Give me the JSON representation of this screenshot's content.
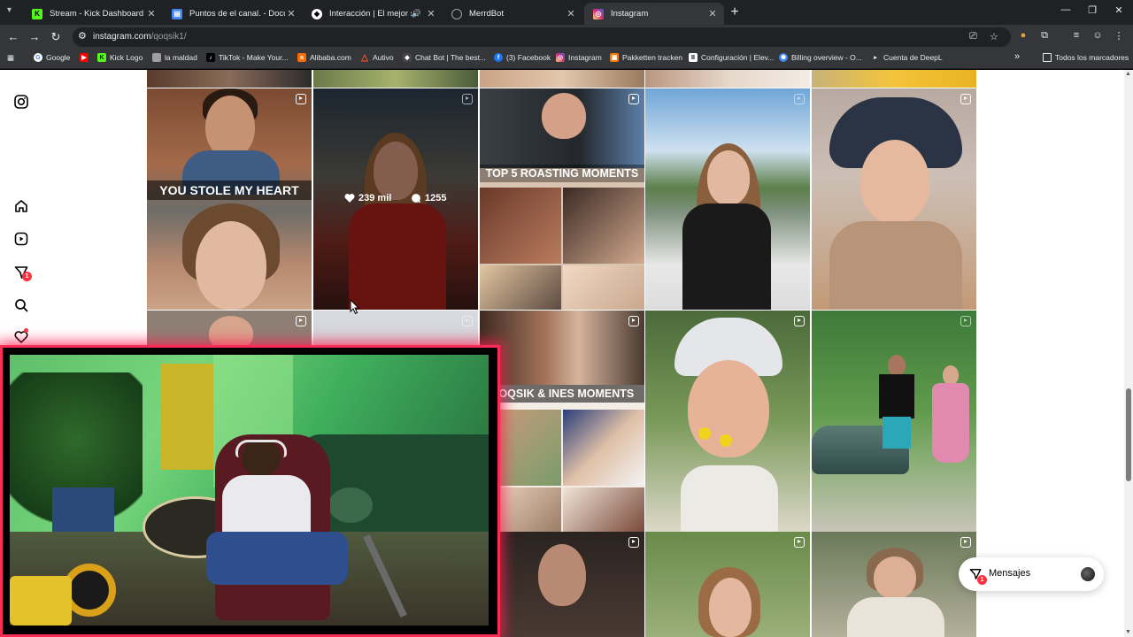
{
  "browser": {
    "tabs": [
      {
        "title": "Stream - Kick Dashboard",
        "favicon": "kick-icon",
        "active": false
      },
      {
        "title": "Puntos de el canal. - Documento",
        "favicon": "docs-icon",
        "active": false
      },
      {
        "title": "Interacción | El mejor softw",
        "favicon": "interaccion-icon",
        "active": false,
        "audio": true
      },
      {
        "title": "MerrdBot",
        "favicon": "globe-icon",
        "active": false
      },
      {
        "title": "Instagram",
        "favicon": "instagram-icon",
        "active": true
      }
    ],
    "url": "instagram.com/qoqsik1/",
    "bookmarks": [
      {
        "label": "Google",
        "color": "#4285f4"
      },
      {
        "label": "",
        "color": "#ff0000"
      },
      {
        "label": "Kick Logo",
        "color": "#53fc18"
      },
      {
        "label": "la maldad",
        "color": "#9e9e9e"
      },
      {
        "label": "TikTok - Make Your...",
        "color": "#000000"
      },
      {
        "label": "Alibaba.com",
        "color": "#ff6a00"
      },
      {
        "label": "Autivo",
        "color": "#ff5722"
      },
      {
        "label": "Chat Bot | The best...",
        "color": "#444444"
      },
      {
        "label": "(3) Facebook",
        "color": "#1877f2"
      },
      {
        "label": "Instagram",
        "color": "#d6249f"
      },
      {
        "label": "Pakketten tracken",
        "color": "#f57c00"
      },
      {
        "label": "Configuración | Elev...",
        "color": "#ffffff"
      },
      {
        "label": "Billing overview - O...",
        "color": "#4285f4"
      },
      {
        "label": "Cuenta de DeepL",
        "color": "#0f2b46"
      }
    ],
    "bookmarks_overflow": "»",
    "all_bookmarks": "Todos los marcadores"
  },
  "instagram": {
    "sidebar_badge": "1",
    "grid": {
      "captions": {
        "heart": "YOU STOLE MY HEART",
        "roasting": "TOP 5 ROASTING MOMENTS",
        "ines": "QOQSIK & INES MOMENTS"
      },
      "hover_stats": {
        "likes": "239 mil",
        "comments": "1255"
      }
    },
    "messages": {
      "label": "Mensajes",
      "badge": "1"
    }
  },
  "colors": {
    "accent": "#ff3040",
    "cam_border": "#ff2d55"
  }
}
